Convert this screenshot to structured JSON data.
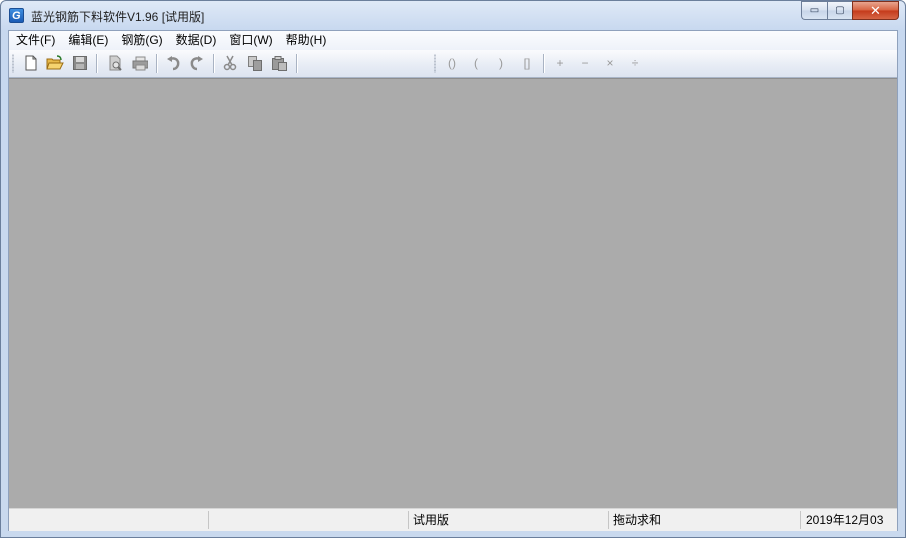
{
  "window": {
    "title": "蓝光钢筋下料软件V1.96 [试用版]",
    "app_icon_letter": "G",
    "minimize_glyph": "▭",
    "maximize_glyph": "▢",
    "close_glyph": "✕"
  },
  "menubar": {
    "items": [
      {
        "label": "文件(F)"
      },
      {
        "label": "编辑(E)"
      },
      {
        "label": "钢筋(G)"
      },
      {
        "label": "数据(D)"
      },
      {
        "label": "窗口(W)"
      },
      {
        "label": "帮助(H)"
      }
    ]
  },
  "toolbar": {
    "buttons": [
      "new-file-icon",
      "open-folder-icon",
      "save-icon",
      "print-preview-icon",
      "print-icon",
      "undo-icon",
      "redo-icon",
      "cut-icon",
      "copy-icon",
      "paste-icon"
    ],
    "operators": [
      "()",
      "(",
      ")",
      "[]",
      "+",
      "−",
      "×",
      "÷"
    ]
  },
  "statusbar": {
    "pane1": "",
    "pane2": "",
    "pane3": "试用版",
    "pane4": "拖动求和",
    "pane5": "2019年12月03"
  }
}
